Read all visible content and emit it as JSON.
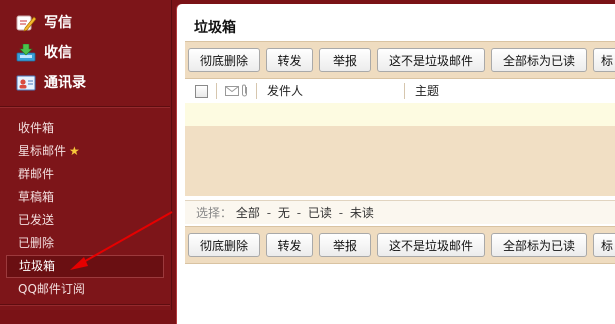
{
  "sidebar": {
    "primary": [
      {
        "label": "写信",
        "icon": "compose-icon"
      },
      {
        "label": "收信",
        "icon": "inbox-download-icon"
      },
      {
        "label": "通讯录",
        "icon": "contacts-icon"
      }
    ],
    "folders": [
      {
        "label": "收件箱"
      },
      {
        "label": "星标邮件",
        "star": "★"
      },
      {
        "label": "群邮件"
      },
      {
        "label": "草稿箱"
      },
      {
        "label": "已发送"
      },
      {
        "label": "已删除"
      },
      {
        "label": "垃圾箱",
        "active": true
      },
      {
        "label": "QQ邮件订阅"
      }
    ]
  },
  "main": {
    "title": "垃圾箱",
    "toolbar": {
      "delete_forever": "彻底删除",
      "forward": "转发",
      "report": "举报",
      "not_spam": "这不是垃圾邮件",
      "mark_all_read": "全部标为已读",
      "mark_truncated": "标"
    },
    "table": {
      "columns": {
        "sender": "发件人",
        "subject": "主题"
      }
    },
    "select": {
      "prefix": "选择：",
      "all": "全部",
      "none": "无",
      "read": "已读",
      "unread": "未读",
      "separator": "-"
    }
  },
  "colors": {
    "sidebar_bg": "#7d1519",
    "toolbar_bg": "#efdcc0",
    "list_bg": "#f1dfc4",
    "empty_row_bg": "#fdfbe1",
    "annotation_arrow": "#e60000"
  }
}
